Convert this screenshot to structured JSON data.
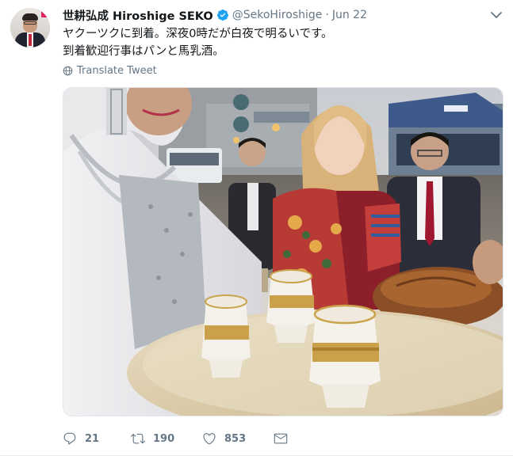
{
  "tweet": {
    "author_name": "世耕弘成 Hiroshige SEKO",
    "handle": "@SekoHiroshige",
    "separator": "·",
    "date": "Jun 22",
    "text_lines": [
      "ヤクーツクに到着。深夜0時だが白夜で明るいです。",
      "到着歓迎行事はパンと馬乳酒。"
    ],
    "translate_label": "Translate Tweet",
    "reply_count": "21",
    "retweet_count": "190",
    "like_count": "853"
  },
  "icons": {
    "verified": "verified-badge-icon",
    "caret": "chevron-down-icon",
    "translate": "globe-icon",
    "reply": "reply-icon",
    "retweet": "retweet-icon",
    "like": "heart-icon",
    "dm": "envelope-icon"
  },
  "colors": {
    "text": "#14171a",
    "secondary": "#657786",
    "verified": "#1da1f2",
    "border": "#e6ecf0"
  }
}
